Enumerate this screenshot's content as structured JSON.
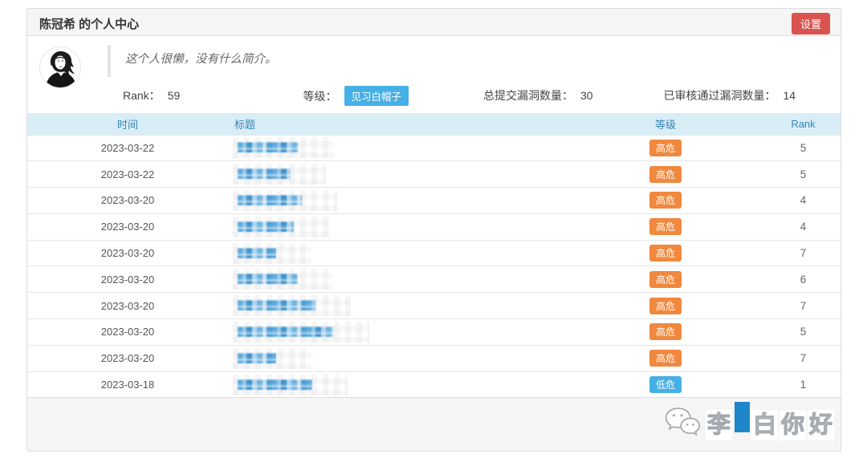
{
  "header": {
    "title": "陈冠希 的个人中心",
    "settings_label": "设置"
  },
  "profile": {
    "bio": "这个人很懒，没有什么简介。",
    "stats": [
      {
        "label": "Rank：",
        "value": "59"
      },
      {
        "label": "等级：",
        "value": "见习白帽子"
      },
      {
        "label": "总提交漏洞数量：",
        "value": "30"
      },
      {
        "label": "已审核通过漏洞数量：",
        "value": "14"
      }
    ]
  },
  "table": {
    "columns": [
      "时间",
      "标题",
      "等级",
      "Rank"
    ],
    "rows": [
      {
        "date": "2023-03-22",
        "title_redacted": true,
        "blur_width": 76,
        "severity": "高危",
        "severity_type": "high",
        "rank": "5"
      },
      {
        "date": "2023-03-22",
        "title_redacted": true,
        "blur_width": 66,
        "severity": "高危",
        "severity_type": "high",
        "rank": "5"
      },
      {
        "date": "2023-03-20",
        "title_redacted": true,
        "blur_width": 80,
        "severity": "高危",
        "severity_type": "high",
        "rank": "4"
      },
      {
        "date": "2023-03-20",
        "title_redacted": true,
        "blur_width": 70,
        "severity": "高危",
        "severity_type": "high",
        "rank": "4"
      },
      {
        "date": "2023-03-20",
        "title_redacted": true,
        "blur_width": 48,
        "severity": "高危",
        "severity_type": "high",
        "rank": "7"
      },
      {
        "date": "2023-03-20",
        "title_redacted": true,
        "blur_width": 75,
        "severity": "高危",
        "severity_type": "high",
        "rank": "6"
      },
      {
        "date": "2023-03-20",
        "title_redacted": true,
        "blur_width": 97,
        "severity": "高危",
        "severity_type": "high",
        "rank": "7"
      },
      {
        "date": "2023-03-20",
        "title_redacted": true,
        "blur_width": 120,
        "severity": "高危",
        "severity_type": "high",
        "rank": "5"
      },
      {
        "date": "2023-03-20",
        "title_redacted": true,
        "blur_width": 48,
        "severity": "高危",
        "severity_type": "high",
        "rank": "7"
      },
      {
        "date": "2023-03-18",
        "title_redacted": true,
        "blur_width": 93,
        "severity": "低危",
        "severity_type": "low",
        "rank": "1"
      }
    ]
  },
  "footer": {
    "watermark_text": "李白你好",
    "watermark_chars": [
      "李",
      "白",
      "你",
      "好"
    ],
    "watermark_icon": "wechat-icon"
  },
  "colors": {
    "settings_button": "#d9534f",
    "table_header_bg": "#d9edf7",
    "table_header_text": "#3585b5",
    "severity_high": "#f0883e",
    "severity_low": "#45b0e6",
    "level_badge": "#45b0e6",
    "watermark_highlight": "#1e86c8"
  }
}
